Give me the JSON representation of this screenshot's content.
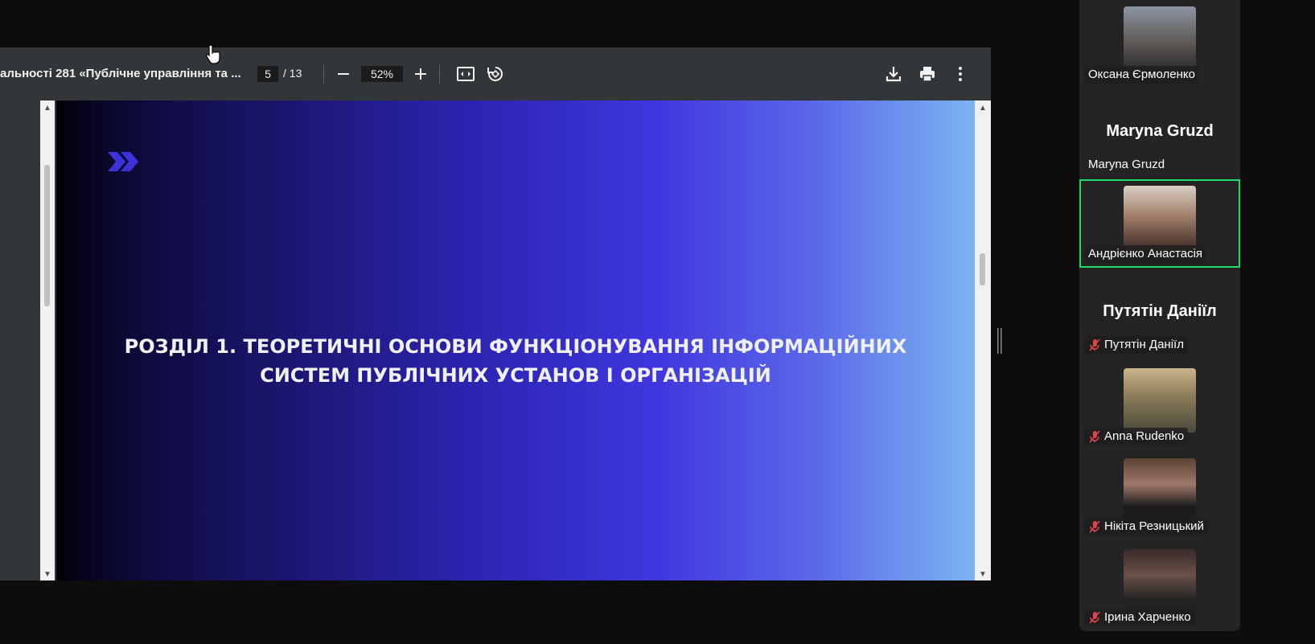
{
  "pdf_viewer": {
    "title": "альності 281 «Публічне управління та ...",
    "current_page": "5",
    "total_pages": "/ 13",
    "zoom": "52%",
    "slide": {
      "heading_line1": "РОЗДІЛ 1. ТЕОРЕТИЧНІ ОСНОВИ ФУНКЦІОНУВАННЯ ІНФОРМАЦІЙНИХ",
      "heading_line2": "СИСТЕМ ПУБЛІЧНИХ УСТАНОВ І ОРГАНІЗАЦІЙ"
    }
  },
  "participants": [
    {
      "name": "Оксана Єрмоленко",
      "video": true,
      "muted": false,
      "active": false,
      "photo_color": "#6b6f78"
    },
    {
      "name": "Maryna Gruzd",
      "display_name": "Maryna Gruzd",
      "video": false,
      "muted": false,
      "active": false
    },
    {
      "name": "Андрієнко Анастасія",
      "video": true,
      "muted": false,
      "active": true,
      "photo_color": "#8a6a5c"
    },
    {
      "name": "Путятін Даніїл",
      "display_name": "Путятін Даніїл",
      "video": false,
      "muted": true,
      "active": false
    },
    {
      "name": "Anna Rudenko",
      "video": true,
      "muted": true,
      "active": false,
      "photo_color": "#9a8a6a"
    },
    {
      "name": "Нікіта Резницький",
      "video": true,
      "muted": true,
      "active": false,
      "photo_color": "#7a5a44"
    },
    {
      "name": "Ірина Харченко",
      "video": true,
      "muted": true,
      "active": false,
      "photo_color": "#4a3c3a"
    }
  ],
  "colors": {
    "active_speaker_border": "#23d96a",
    "muted_icon": "#e0454a",
    "toolbar_bg": "#323639"
  }
}
